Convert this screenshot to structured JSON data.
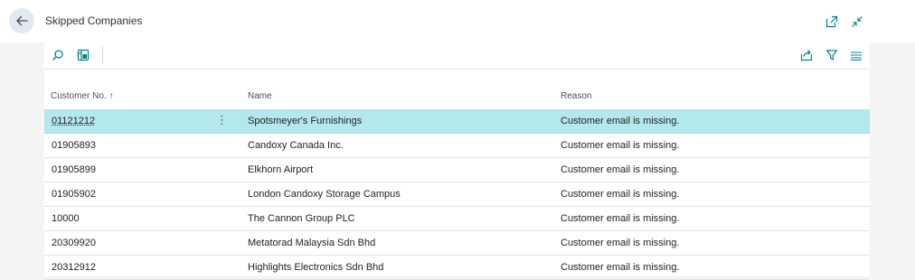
{
  "header": {
    "title": "Skipped Companies",
    "icons": {
      "back": "back-arrow-icon",
      "open_new": "open-in-new-window-icon",
      "collapse": "collapse-icon"
    }
  },
  "toolbar": {
    "icons": [
      "search-icon",
      "layout-panel-icon",
      "share-icon",
      "filter-icon",
      "list-view-icon"
    ]
  },
  "table": {
    "columns": {
      "customer_no": "Customer No. ↑",
      "name": "Name",
      "reason": "Reason"
    },
    "rows": [
      {
        "no": "01121212",
        "name": "Spotsmeyer's Furnishings",
        "reason": "Customer email is missing.",
        "selected": true
      },
      {
        "no": "01905893",
        "name": "Candoxy Canada Inc.",
        "reason": "Customer email is missing."
      },
      {
        "no": "01905899",
        "name": "Elkhorn Airport",
        "reason": "Customer email is missing."
      },
      {
        "no": "01905902",
        "name": "London Candoxy Storage Campus",
        "reason": "Customer email is missing."
      },
      {
        "no": "10000",
        "name": "The Cannon Group PLC",
        "reason": "Customer email is missing."
      },
      {
        "no": "20309920",
        "name": "Metatorad Malaysia Sdn Bhd",
        "reason": "Customer email is missing."
      },
      {
        "no": "20312912",
        "name": "Highlights Electronics Sdn Bhd",
        "reason": "Customer email is missing."
      }
    ]
  },
  "colors": {
    "accent": "#008489",
    "selected_row": "#b3e8ed",
    "page_bg": "#f4f4f4"
  }
}
